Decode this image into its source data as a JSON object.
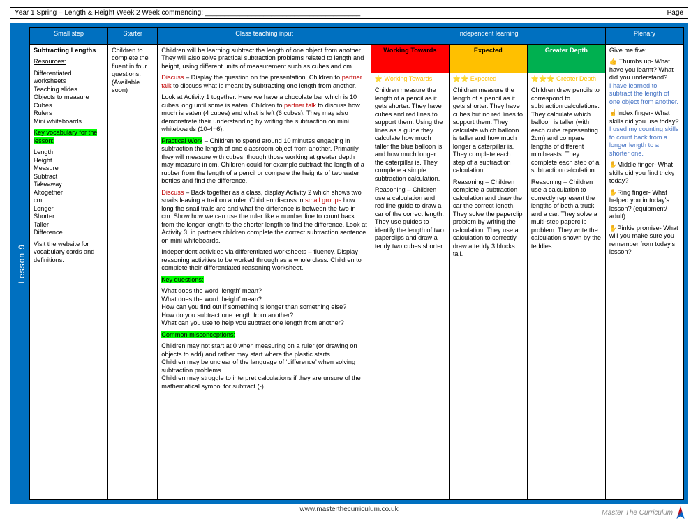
{
  "topbar": {
    "left": "Year 1 Spring – Length & Height Week 2        Week commencing: ________________________________________",
    "right": "Page"
  },
  "lesson_tab": "Lesson 9",
  "headers": {
    "smallstep": "Small step",
    "starter": "Starter",
    "teaching": "Class teaching input",
    "independent": "Independent learning",
    "plenary": "Plenary",
    "wt": "Working Towards",
    "ex": "Expected",
    "gd": "Greater Depth"
  },
  "smallstep": {
    "title": "Subtracting Lengths",
    "resources_label": "Resources:",
    "resources": "Differentiated worksheets\nTeaching slides\nObjects to measure\nCubes\nRulers\nMini whiteboards",
    "keyvocab_label": "Key vocabulary for the lesson:",
    "vocab": "Length\nHeight\nMeasure\nSubtract\nTakeaway\nAltogether\ncm\nLonger\nShorter\nTaller\nDifference",
    "visit": "Visit the website for vocabulary cards and definitions."
  },
  "starter": "Children to complete the fluent in four questions. (Available soon)",
  "teaching": {
    "intro": "Children will be learning subtract the length of one object from another. They will also solve practical subtraction problems related to length and height, using different units of measurement such as cubes and cm.",
    "discuss1_pre": "Discuss",
    "discuss1_body": " – Display the question on the presentation. Children to ",
    "partner": "partner talk",
    "discuss1_post": " to discuss what is meant by subtracting one length from another.",
    "activity1a": "Look at Activity 1 together. Here we have a chocolate bar which is 10 cubes long until some is eaten. Children to ",
    "activity1b": " to discuss how much is eaten (4 cubes) and what is left (6 cubes). They may also demonstrate their understanding by writing the subtraction on mini whiteboards (10-4=6).",
    "practical_label": "Practical Work",
    "practical_body": " – Children to spend around 10 minutes engaging in subtraction the length of one classroom object from another. Primarily they will measure with cubes, though those working at greater depth may measure in cm. Children could for example subtract the length of a rubber from the length of a pencil or compare the heights of two water bottles and find the difference.",
    "discuss2_pre": "Discuss",
    "discuss2_body1": " – Back together as a class, display Activity 2 which shows two snails leaving a trail on a ruler. Children discuss in ",
    "smallgroups": "small groups",
    "discuss2_body2": " how long the snail trails are and what the difference is between the two in cm. Show how we can use the ruler like a number line to count back from the longer length to the shorter length to find the difference. Look at Activity 3, in partners children complete the correct subtraction sentence on mini whiteboards.",
    "indep": "Independent activities via differentiated worksheets – fluency. Display reasoning activities to be worked through as a whole class. Children to complete their differentiated reasoning worksheet.",
    "keyq_label": "Key questions:",
    "keyq": "What does the word ‘length’ mean?\nWhat does the word ‘height’ mean?\nHow can you find out if something is longer than something else?\nHow do you subtract one length from another?\nWhat can you use to help you subtract one length from another?",
    "misc_label": "Common misconceptions:",
    "misc": "Children may not start at 0 when measuring on a ruler (or drawing on objects to add) and rather may start where the plastic starts.\nChildren may be unclear of the language of ‘difference’ when solving subtraction problems.\nChildren may struggle to interpret calculations if they are unsure of the mathematical symbol for subtract (-)."
  },
  "il": {
    "wt_stars": "⭐ Working Towards",
    "wt_body": "Children measure the length of a pencil as it gets shorter. They have cubes and red lines to support them. Using the lines as a guide they calculate how much taller the blue balloon is and how much longer the caterpillar is. They complete a simple subtraction calculation.",
    "wt_reason": "Reasoning – Children use a calculation and red line guide to draw a car of the correct length. They use guides to identify the length of two paperclips and draw a teddy two cubes shorter.",
    "ex_stars": "⭐⭐ Expected",
    "ex_body": "Children measure the length of a pencil as it gets shorter. They have cubes but no red lines to support them. They calculate which balloon is taller and how much longer a caterpillar is. They complete each step of a subtraction calculation.",
    "ex_reason": "Reasoning – Children complete a subtraction calculation and draw the car the correct length. They solve the paperclip problem by writing the calculation. They use a calculation to correctly draw a teddy 3 blocks tall.",
    "gd_stars": "⭐⭐⭐ Greater Depth",
    "gd_body": "Children draw pencils to correspond to subtraction calculations. They calculate which balloon is taller (with each cube representing 2cm) and compare lengths of different minibeasts. They complete each step of a subtraction calculation.",
    "gd_reason": "Reasoning – Children use a calculation to correctly represent the lengths of both a truck and a car. They solve a multi-step paperclip problem. They write the calculation shown by the teddies."
  },
  "plenary": {
    "intro": "Give me five:",
    "thumb_q": "👍 Thumbs up- What have you learnt? What did you understand?",
    "thumb_a": "I have learned to subtract the length of one object from another.",
    "index_q": "☝️Index finger- What skills did you use today?",
    "index_a": "I used my counting skills to count back from a longer length to a shorter one.",
    "middle": "✋Middle finger- What skills did you find tricky today?",
    "ring": "✋Ring finger- What helped you in today's lesson? (equipment/ adult)",
    "pinkie": "✋Pinkie promise- What will you make sure you remember from today's lesson?"
  },
  "footer": "www.masterthecurriculum.co.uk",
  "watermark": "Master The Curriculum"
}
